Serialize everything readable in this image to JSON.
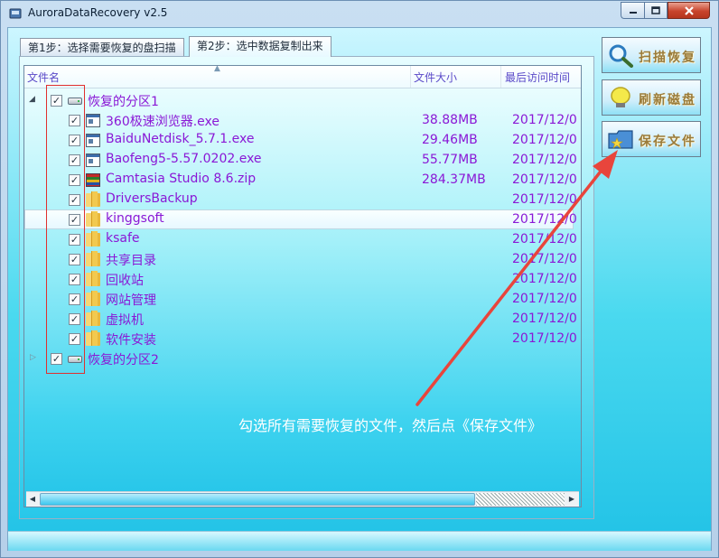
{
  "window": {
    "title": "AuroraDataRecovery v2.5"
  },
  "tabs": [
    {
      "label": "第1步：选择需要恢复的盘扫描"
    },
    {
      "label": "第2步：选中数据复制出来"
    }
  ],
  "columns": {
    "name": "文件名",
    "size": "文件大小",
    "time": "最后访问时间"
  },
  "tree": {
    "partition1": {
      "label": "恢复的分区1",
      "checked": true,
      "expanded": true
    },
    "files": [
      {
        "name": "360极速浏览器.exe",
        "size": "38.88MB",
        "time": "2017/12/0",
        "icon": "exe-icon"
      },
      {
        "name": "BaiduNetdisk_5.7.1.exe",
        "size": "29.46MB",
        "time": "2017/12/0",
        "icon": "exe-icon"
      },
      {
        "name": "Baofeng5-5.57.0202.exe",
        "size": "55.77MB",
        "time": "2017/12/0",
        "icon": "exe-icon"
      },
      {
        "name": "Camtasia Studio 8.6.zip",
        "size": "284.37MB",
        "time": "2017/12/0",
        "icon": "archive-icon"
      },
      {
        "name": "DriversBackup",
        "size": "",
        "time": "2017/12/0",
        "icon": "folder-icon"
      },
      {
        "name": "kinggsoft",
        "size": "",
        "time": "2017/12/0",
        "icon": "folder-icon"
      },
      {
        "name": "ksafe",
        "size": "",
        "time": "2017/12/0",
        "icon": "folder-icon"
      },
      {
        "name": "共享目录",
        "size": "",
        "time": "2017/12/0",
        "icon": "folder-icon"
      },
      {
        "name": "回收站",
        "size": "",
        "time": "2017/12/0",
        "icon": "folder-icon"
      },
      {
        "name": "网站管理",
        "size": "",
        "time": "2017/12/0",
        "icon": "folder-icon"
      },
      {
        "name": "虚拟机",
        "size": "",
        "time": "2017/12/0",
        "icon": "folder-icon"
      },
      {
        "name": "软件安装",
        "size": "",
        "time": "2017/12/0",
        "icon": "folder-icon"
      }
    ],
    "partition2": {
      "label": "恢复的分区2",
      "checked": true,
      "expanded": false
    }
  },
  "buttons": {
    "scan": "扫描恢复",
    "refresh": "刷新磁盘",
    "save": "保存文件"
  },
  "annotation": "勾选所有需要恢复的文件，然后点《保存文件》",
  "colors": {
    "file_text": "#8a18d6",
    "annotation_box": "#e0302f",
    "arrow": "#e8453c"
  }
}
